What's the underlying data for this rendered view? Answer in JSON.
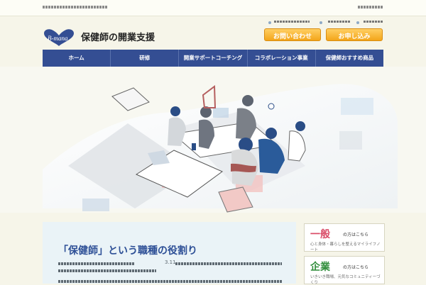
{
  "brand": {
    "name": "保健師の開業支援",
    "logo_text": "B-mana",
    "accent": "#344e93",
    "gold": "#f3a51a"
  },
  "header": {
    "contact_label": "お問い合わせ",
    "apply_label": "お申し込み"
  },
  "nav": {
    "items": [
      "ホーム",
      "研修",
      "開業サポートコーチング",
      "コラボレーション事業",
      "保健師おすすめ商品"
    ]
  },
  "content": {
    "title": "「保健師」という職種の役割り",
    "text_fragment": "3.11"
  },
  "sidebar": {
    "general": {
      "big": "一般",
      "small": "の方はこちら",
      "sub": "心と身体・暮らしを整えるマイライフノート"
    },
    "company": {
      "big": "企業",
      "small": "の方はこちら",
      "sub": "いきいき職場、元気なコミュニティーづくり"
    }
  }
}
